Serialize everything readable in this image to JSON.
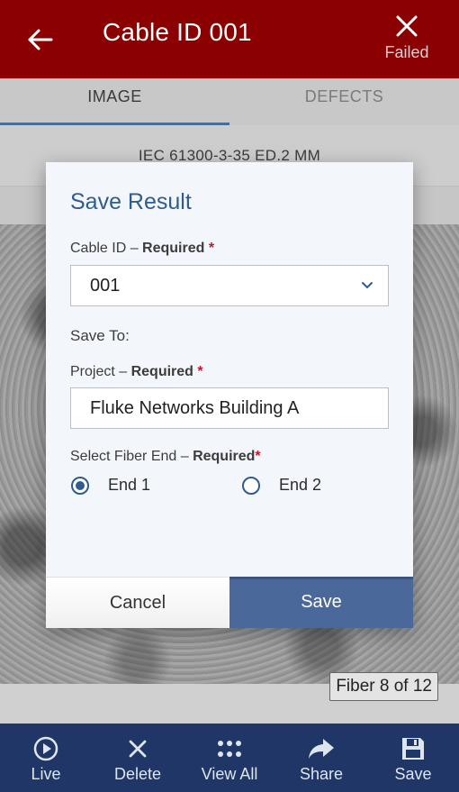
{
  "header": {
    "title": "Cable ID 001",
    "status_label": "Failed",
    "background_color": "#8b0000"
  },
  "tabs": [
    {
      "label": "IMAGE",
      "active": true
    },
    {
      "label": "DEFECTS",
      "active": false
    }
  ],
  "standard": "IEC 61300-3-35 ED.2 MM",
  "fiber_badge": "Fiber 8 of 12",
  "modal": {
    "title": "Save Result",
    "cable_id_label": "Cable ID – ",
    "cable_id_required": "Required",
    "required_mark": "*",
    "cable_id_value": "001",
    "save_to_label": "Save To:",
    "project_label": "Project – ",
    "project_required": "Required",
    "project_value": "Fluke Networks Building A",
    "fiber_end_label": "Select Fiber End – ",
    "fiber_end_required": "Required",
    "fiber_end_options": [
      {
        "label": "End 1",
        "selected": true
      },
      {
        "label": "End 2",
        "selected": false
      }
    ],
    "cancel_label": "Cancel",
    "save_label": "Save"
  },
  "bottom_nav": [
    {
      "label": "Live",
      "icon": "play-circle-icon"
    },
    {
      "label": "Delete",
      "icon": "close-icon"
    },
    {
      "label": "View All",
      "icon": "grid-dots-icon"
    },
    {
      "label": "Share",
      "icon": "share-arrow-icon"
    },
    {
      "label": "Save",
      "icon": "floppy-disk-icon"
    }
  ],
  "colors": {
    "accent": "#2f5c8f",
    "nav_background": "#1f3666",
    "required": "#c0182a"
  }
}
